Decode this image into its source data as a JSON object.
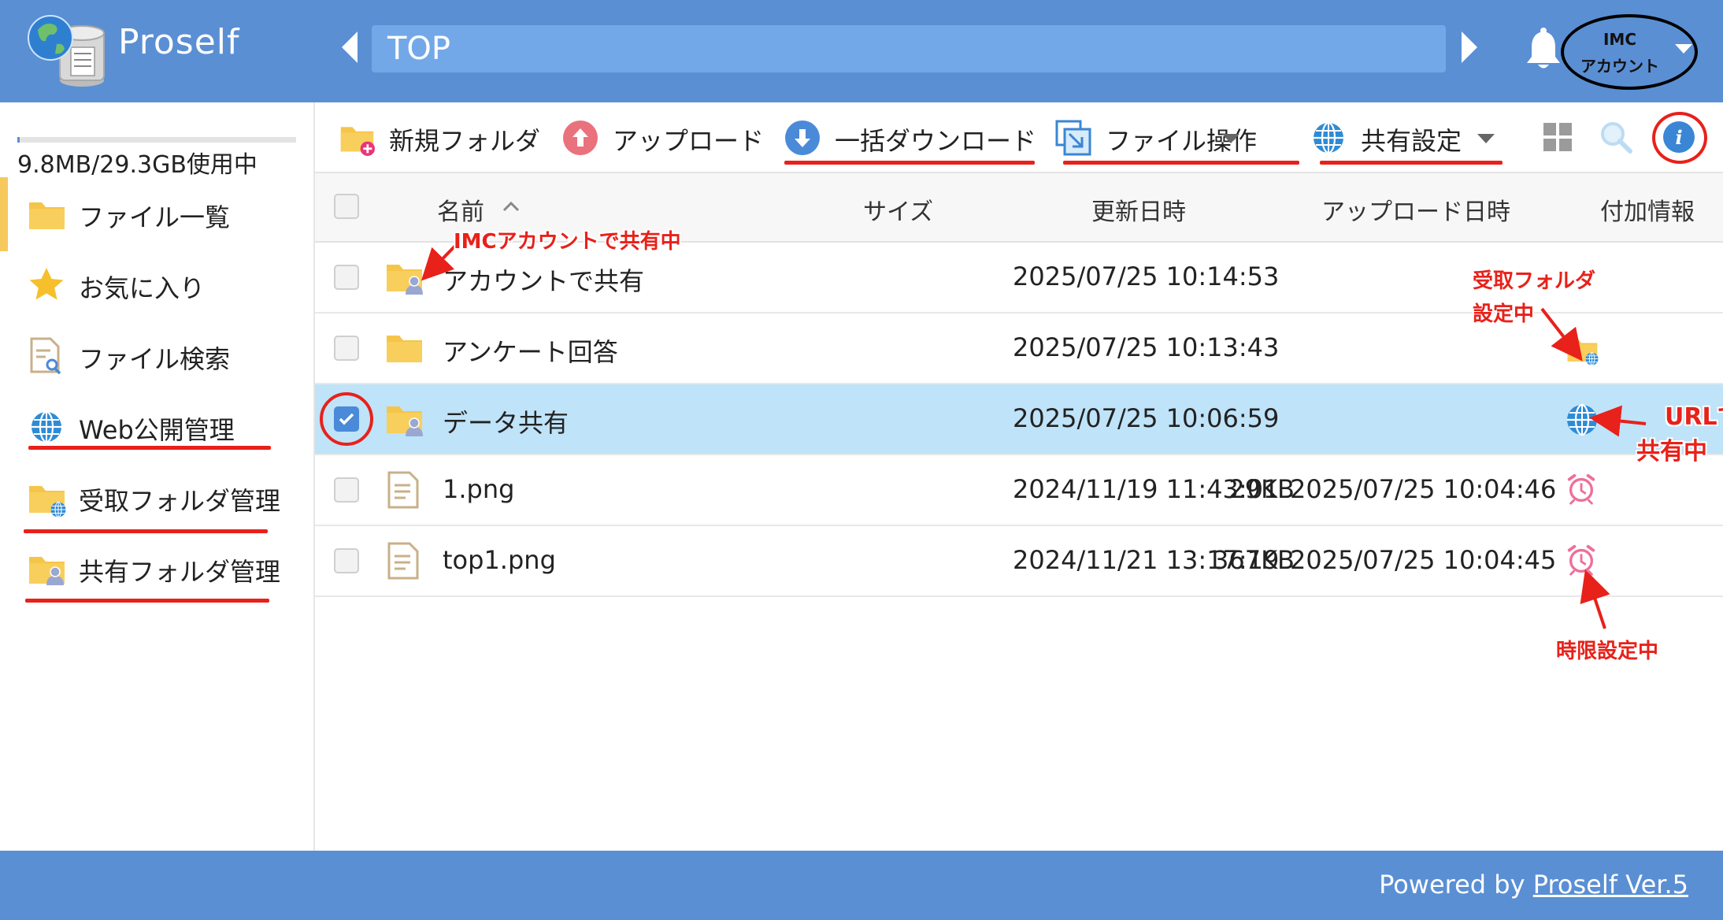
{
  "app": {
    "brand": "Proself"
  },
  "header": {
    "path": "TOP",
    "account_line1": "IMC",
    "account_line2": "アカウント"
  },
  "sidebar": {
    "usage_text": "9.8MB/29.3GB使用中",
    "usage_fraction": 0.0003,
    "items": [
      {
        "label": "ファイル一覧",
        "icon": "folder-icon"
      },
      {
        "label": "お気に入り",
        "icon": "star-icon"
      },
      {
        "label": "ファイル検索",
        "icon": "file-search-icon"
      },
      {
        "label": "Web公開管理",
        "icon": "globe-icon"
      },
      {
        "label": "受取フォルダ管理",
        "icon": "receive-folder-icon"
      },
      {
        "label": "共有フォルダ管理",
        "icon": "shared-folder-icon"
      }
    ]
  },
  "toolbar": {
    "new_folder": "新規フォルダ",
    "upload": "アップロード",
    "bulk_download": "一括ダウンロード",
    "file_ops": "ファイル操作",
    "share_settings": "共有設定"
  },
  "table": {
    "columns": {
      "name": "名前",
      "size": "サイズ",
      "modified": "更新日時",
      "uploaded": "アップロード日時",
      "info": "付加情報"
    },
    "rows": [
      {
        "name": "アカウントで共有",
        "size": "",
        "modified": "2025/07/25 10:14:53",
        "uploaded": "",
        "selected": false,
        "icon": "shared-folder-icon",
        "info_icon": ""
      },
      {
        "name": "アンケート回答",
        "size": "",
        "modified": "2025/07/25 10:13:43",
        "uploaded": "",
        "selected": false,
        "icon": "folder-icon",
        "info_icon": "receive-folder-icon"
      },
      {
        "name": "データ共有",
        "size": "",
        "modified": "2025/07/25 10:06:59",
        "uploaded": "",
        "selected": true,
        "icon": "shared-folder-icon",
        "info_icon": "globe-icon"
      },
      {
        "name": "1.png",
        "size": "29KB",
        "modified": "2024/11/19 11:43:01",
        "uploaded": "2025/07/25 10:04:46",
        "selected": false,
        "icon": "file-icon",
        "info_icon": "alarm-icon"
      },
      {
        "name": "top1.png",
        "size": "367KB",
        "modified": "2024/11/21 13:17:19",
        "uploaded": "2025/07/25 10:04:45",
        "selected": false,
        "icon": "file-icon",
        "info_icon": "alarm-icon"
      }
    ]
  },
  "annotations": {
    "imc_share": "IMCアカウントで共有中",
    "receive_line1": "受取フォルダ",
    "receive_line2": "設定中",
    "url_line1": "URLで",
    "url_line2": "共有中",
    "time_limit": "時限設定中"
  },
  "footer": {
    "prefix": "Powered by ",
    "link": "Proself Ver.5"
  },
  "colors": {
    "header": "#5a8fd4",
    "selected_row": "#bfe3f8",
    "annotation_red": "#e8211a",
    "folder": "#f5c54a"
  }
}
